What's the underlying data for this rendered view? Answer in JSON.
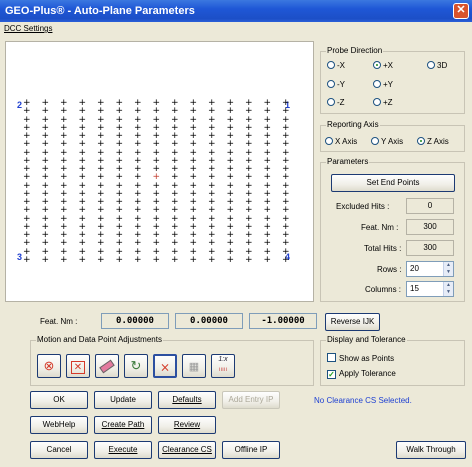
{
  "window": {
    "title": "GEO-Plus® - Auto-Plane Parameters"
  },
  "menu": {
    "dcc_settings": "DCC Settings"
  },
  "canvas": {
    "corner_labels": [
      "2",
      "1",
      "3",
      "4"
    ],
    "grid_rows": 20,
    "grid_cols": 15
  },
  "probe_direction": {
    "title": "Probe Direction",
    "options": [
      "-X",
      "+X",
      "3D",
      "-Y",
      "+Y",
      "-Z",
      "+Z"
    ],
    "selected": "+X"
  },
  "reporting_axis": {
    "title": "Reporting Axis",
    "options": [
      "X Axis",
      "Y Axis",
      "Z Axis"
    ],
    "selected": "Z Axis"
  },
  "parameters": {
    "title": "Parameters",
    "set_end_points": "Set End Points",
    "excluded_hits_label": "Excluded Hits :",
    "excluded_hits_value": "0",
    "feat_nm_label": "Feat. Nm :",
    "feat_nm_value": "300",
    "total_hits_label": "Total Hits :",
    "total_hits_value": "300",
    "rows_label": "Rows :",
    "rows_value": "20",
    "columns_label": "Columns :",
    "columns_value": "15"
  },
  "feat_nm": {
    "label": "Feat. Nm :",
    "values": [
      "0.00000",
      "0.00000",
      "-1.00000"
    ]
  },
  "reverse_ijk": "Reverse IJK",
  "motion": {
    "title": "Motion and Data Point Adjustments",
    "icons": [
      "cancel-circle-icon",
      "delete-x-icon",
      "eraser-icon",
      "rotate-icon",
      "remove-point-icon",
      "grid-icon",
      "scale-icon"
    ],
    "scale_text": "1:x"
  },
  "display": {
    "title": "Display and Tolerance",
    "show_as_points": "Show as Points",
    "show_as_points_checked": false,
    "apply_tolerance": "Apply Tolerance",
    "apply_tolerance_checked": true
  },
  "buttons": {
    "ok": "OK",
    "update": "Update",
    "defaults": "Defaults",
    "add_entry_ip": "Add Entry IP",
    "webhelp": "WebHelp",
    "create_path": "Create Path",
    "review": "Review",
    "cancel": "Cancel",
    "execute": "Execute",
    "clearance_cs": "Clearance CS",
    "offline_ip": "Offline IP",
    "walk_through": "Walk Through"
  },
  "status_text": "No Clearance CS Selected."
}
